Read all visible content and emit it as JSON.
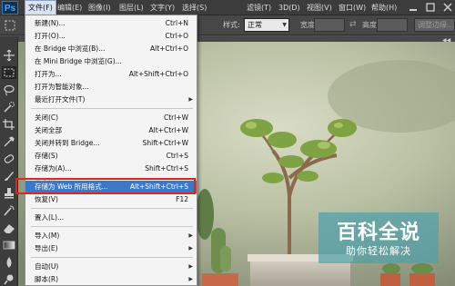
{
  "app": {
    "logo_text": "Ps",
    "menubar": [
      {
        "id": "file",
        "label": "文件(F)"
      },
      {
        "id": "edit",
        "label": "编辑(E)"
      },
      {
        "id": "image",
        "label": "图像(I)"
      },
      {
        "id": "layer",
        "label": "图层(L)"
      },
      {
        "id": "type",
        "label": "文字(Y)"
      },
      {
        "id": "select",
        "label": "选择(S)"
      },
      {
        "id": "filter",
        "label": "滤镜(T)"
      },
      {
        "id": "3d",
        "label": "3D(D)"
      },
      {
        "id": "view",
        "label": "视图(V)"
      },
      {
        "id": "window",
        "label": "窗口(W)"
      },
      {
        "id": "help",
        "label": "帮助(H)"
      }
    ],
    "active_menu": "file"
  },
  "options_bar": {
    "style_label": "样式:",
    "style_value": "正常",
    "width_label": "宽度:",
    "height_label": "高度:",
    "refine_edge_label": "调整边缘..."
  },
  "file_menu": {
    "items": [
      {
        "label": "新建(N)...",
        "shortcut": "Ctrl+N"
      },
      {
        "label": "打开(O)...",
        "shortcut": "Ctrl+O"
      },
      {
        "label": "在 Bridge 中浏览(B)...",
        "shortcut": "Alt+Ctrl+O"
      },
      {
        "label": "在 Mini Bridge 中浏览(G)...",
        "shortcut": ""
      },
      {
        "label": "打开为...",
        "shortcut": "Alt+Shift+Ctrl+O"
      },
      {
        "label": "打开为智能对象...",
        "shortcut": ""
      },
      {
        "label": "最近打开文件(T)",
        "shortcut": "",
        "submenu": true
      },
      {
        "label": "关闭(C)",
        "shortcut": "Ctrl+W"
      },
      {
        "label": "关闭全部",
        "shortcut": "Alt+Ctrl+W"
      },
      {
        "label": "关闭并转到 Bridge...",
        "shortcut": "Shift+Ctrl+W"
      },
      {
        "label": "存储(S)",
        "shortcut": "Ctrl+S"
      },
      {
        "label": "存储为(A)...",
        "shortcut": "Shift+Ctrl+S"
      },
      {
        "label": "签入(I)...",
        "shortcut": "",
        "disabled": true
      },
      {
        "label": "存储为 Web 所用格式...",
        "shortcut": "Alt+Shift+Ctrl+S",
        "highlighted": true
      },
      {
        "label": "恢复(V)",
        "shortcut": "F12"
      },
      {
        "label": "置入(L)...",
        "shortcut": ""
      },
      {
        "label": "导入(M)",
        "shortcut": "",
        "submenu": true
      },
      {
        "label": "导出(E)",
        "shortcut": "",
        "submenu": true
      },
      {
        "label": "自动(U)",
        "shortcut": "",
        "submenu": true
      },
      {
        "label": "脚本(R)",
        "shortcut": "",
        "submenu": true
      }
    ]
  },
  "watermark": {
    "title": "百科全说",
    "subtitle": "助你轻松解决",
    "color": "#50a0aa"
  },
  "colors": {
    "menu_highlight": "#3b78c7",
    "callout_frame": "#e1251d",
    "ps_blue": "#49a7f5"
  }
}
